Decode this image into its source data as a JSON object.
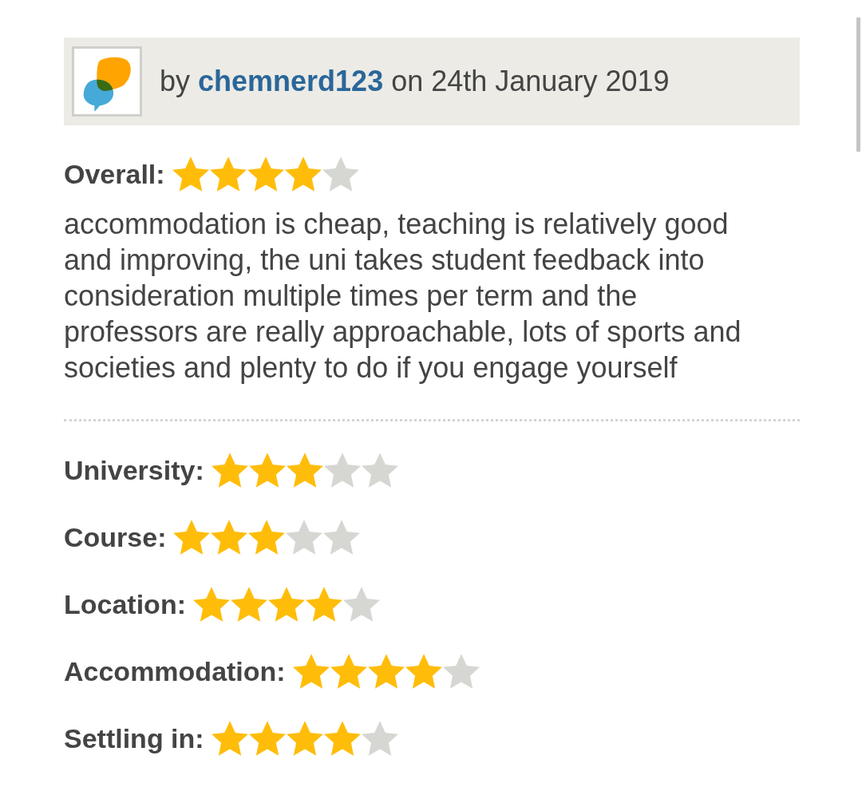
{
  "review_header": {
    "prefix": "by",
    "author": "chemnerd123",
    "date_text": "on 24th January 2019"
  },
  "overall": {
    "label": "Overall:",
    "stars": 4
  },
  "review_text": "accommodation is cheap, teaching is relatively good and improving, the uni takes student feedback into consideration multiple times per term and the professors are really approachable, lots of sports and societies and plenty to do if you engage yourself",
  "ratings": [
    {
      "label": "University:",
      "stars": 3
    },
    {
      "label": "Course:",
      "stars": 3
    },
    {
      "label": "Location:",
      "stars": 4
    },
    {
      "label": "Accommodation:",
      "stars": 4
    },
    {
      "label": "Settling in:",
      "stars": 4
    }
  ]
}
